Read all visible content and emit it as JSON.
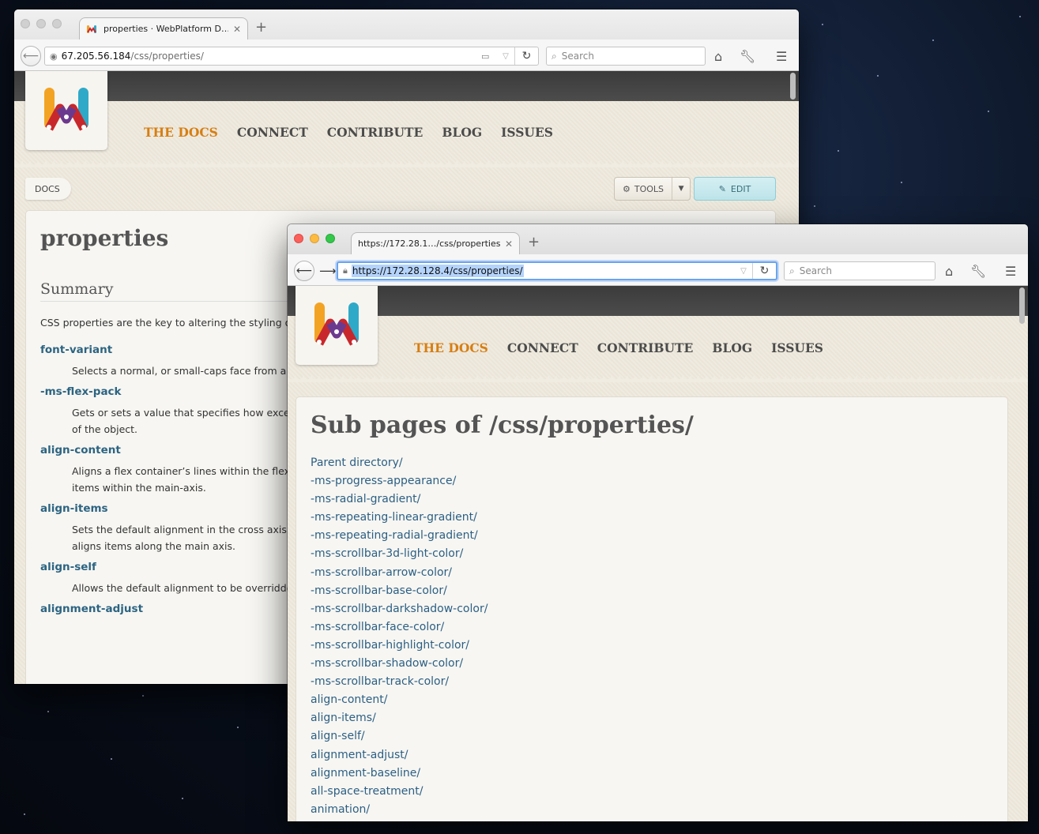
{
  "back_window": {
    "tab": {
      "title": "properties · WebPlatform D…",
      "close": "✕"
    },
    "newtab": "+",
    "url": {
      "host": "67.205.56.184",
      "path": "/css/properties/"
    },
    "search_placeholder": "Search",
    "site": {
      "nav": [
        "THE DOCS",
        "CONNECT",
        "CONTRIBUTE",
        "BLOG",
        "ISSUES"
      ],
      "breadcrumb": "DOCS",
      "tools_label": "TOOLS",
      "edit_label": "EDIT",
      "title": "properties",
      "summary_heading": "Summary",
      "summary_text": "CSS properties are the key to altering the styling of H",
      "props": [
        {
          "name": "font-variant",
          "desc": [
            "Selects a normal, or small-caps face from a fon"
          ]
        },
        {
          "name": "-ms-flex-pack",
          "desc": [
            "Gets or sets a value that specifies how excess s",
            "of the object."
          ]
        },
        {
          "name": "align-content",
          "desc": [
            "Aligns a flex container’s lines within the flex co",
            "items within the main-axis."
          ]
        },
        {
          "name": "align-items",
          "desc": [
            "Sets the default alignment in the cross axis for",
            "aligns items along the main axis."
          ]
        },
        {
          "name": "align-self",
          "desc": [
            "Allows the default alignment to be overridden"
          ]
        },
        {
          "name": "alignment-adjust",
          "desc": []
        }
      ]
    }
  },
  "front_window": {
    "tab": {
      "title": "https://172.28.1…/css/properties/",
      "close": "✕"
    },
    "newtab": "+",
    "url": "https://172.28.128.4/css/properties/",
    "search_placeholder": "Search",
    "site": {
      "nav": [
        "THE DOCS",
        "CONNECT",
        "CONTRIBUTE",
        "BLOG",
        "ISSUES"
      ],
      "title": "Sub pages of /css/properties/",
      "links": [
        "Parent directory/",
        "-ms-progress-appearance/",
        "-ms-radial-gradient/",
        "-ms-repeating-linear-gradient/",
        "-ms-repeating-radial-gradient/",
        "-ms-scrollbar-3d-light-color/",
        "-ms-scrollbar-arrow-color/",
        "-ms-scrollbar-base-color/",
        "-ms-scrollbar-darkshadow-color/",
        "-ms-scrollbar-face-color/",
        "-ms-scrollbar-highlight-color/",
        "-ms-scrollbar-shadow-color/",
        "-ms-scrollbar-track-color/",
        "align-content/",
        "align-items/",
        "align-self/",
        "alignment-adjust/",
        "alignment-baseline/",
        "all-space-treatment/",
        "animation/"
      ]
    }
  },
  "colors": {
    "accent_nav": "#d77e12",
    "link": "#2c5f84",
    "property_name": "#2c6482",
    "url_focus": "#6aa4f0"
  },
  "icons": [
    "back-arrow-icon",
    "forward-arrow-icon",
    "lock-icon",
    "globe-icon",
    "reload-icon",
    "reader-view-icon",
    "search-icon",
    "home-icon",
    "wrench-icon",
    "hamburger-menu-icon",
    "gear-icon",
    "pencil-icon",
    "webplatform-logo-icon"
  ]
}
